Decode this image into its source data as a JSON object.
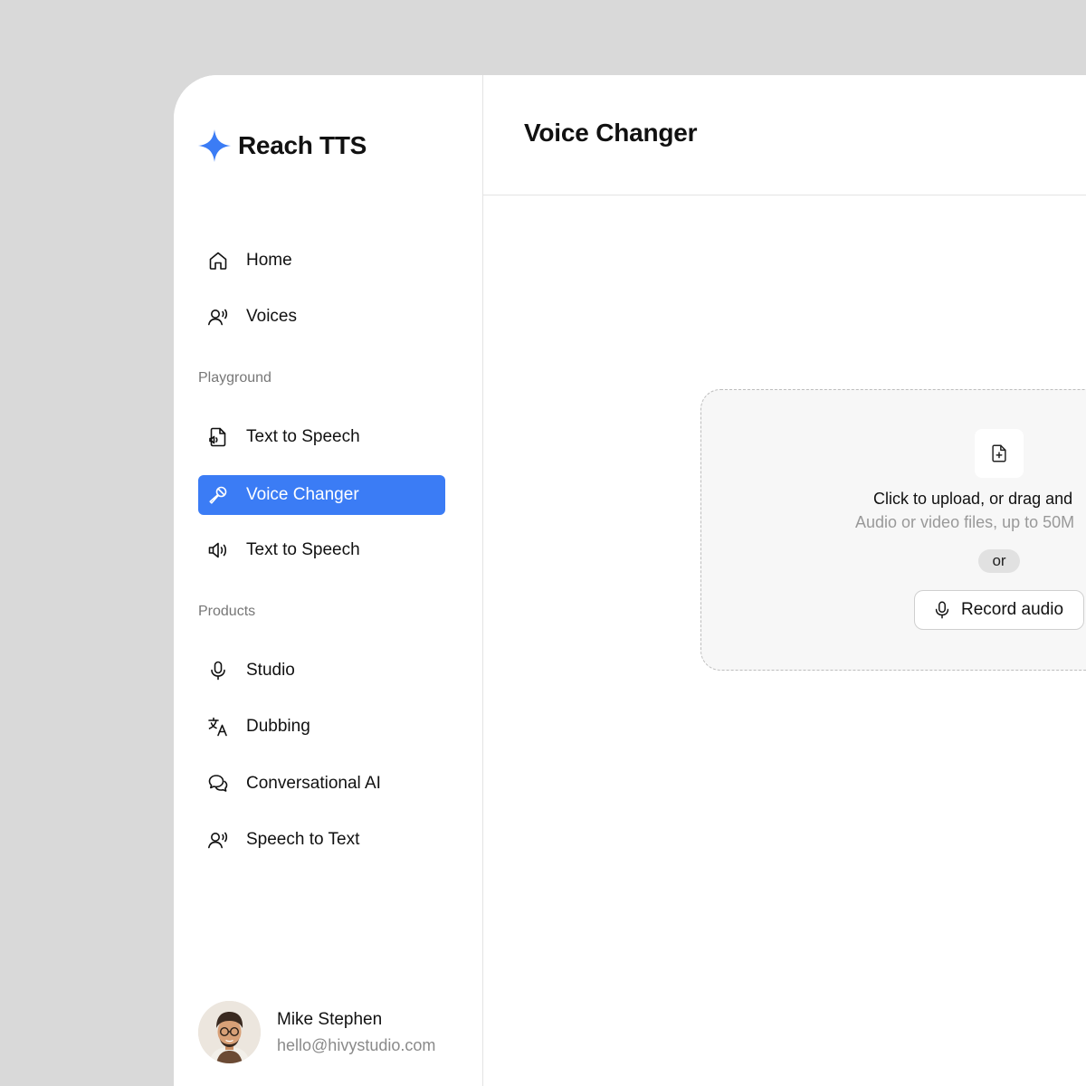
{
  "app": {
    "name": "Reach TTS",
    "accent": "#3b7cf5"
  },
  "sidebar": {
    "top_items": [
      {
        "label": "Home",
        "icon": "home-icon"
      },
      {
        "label": "Voices",
        "icon": "voice-user-icon"
      }
    ],
    "sections": [
      {
        "label": "Playground",
        "items": [
          {
            "label": "Text to Speech",
            "icon": "audio-file-icon"
          },
          {
            "label": "Voice Changer",
            "icon": "microphone-wand-icon",
            "active": true
          },
          {
            "label": "Text to Speech",
            "icon": "speaker-icon"
          }
        ]
      },
      {
        "label": "Products",
        "items": [
          {
            "label": "Studio",
            "icon": "microphone-icon"
          },
          {
            "label": "Dubbing",
            "icon": "translate-icon"
          },
          {
            "label": "Conversational AI",
            "icon": "chat-bubbles-icon"
          },
          {
            "label": "Speech to Text",
            "icon": "voice-user-icon"
          }
        ]
      }
    ],
    "user": {
      "name": "Mike Stephen",
      "email": "hello@hivystudio.com"
    }
  },
  "main": {
    "title": "Voice Changer",
    "upload": {
      "title": "Click to upload, or drag and",
      "subtitle": "Audio or video files, up to 50M",
      "or_label": "or",
      "record_label": "Record audio"
    }
  }
}
